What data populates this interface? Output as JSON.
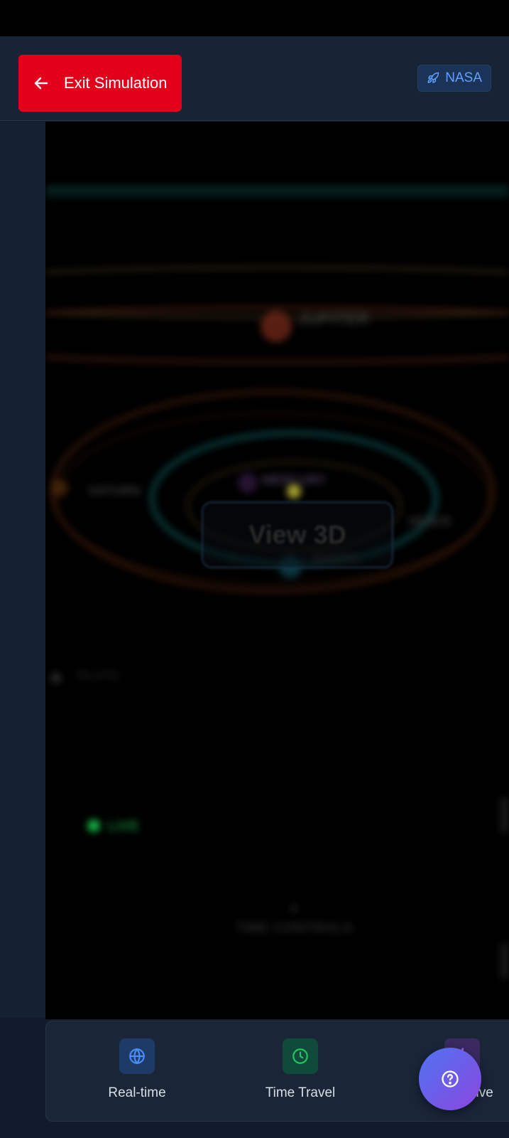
{
  "header": {
    "exit_label": "Exit Simulation",
    "badge_label": "NASA"
  },
  "viewport": {
    "view_button_label": "View 3D",
    "planet_labels": [
      "JUPITER",
      "SATURN",
      "MARS",
      "EARTH",
      "VENUS",
      "MERCURY",
      "PLUTO"
    ],
    "live_label": "LIVE",
    "time_controls_label": "TIME CONTROLS"
  },
  "features": [
    {
      "label": "Real-time",
      "icon": "globe-icon",
      "color": "#4b8df8"
    },
    {
      "label": "Time Travel",
      "icon": "clock-icon",
      "color": "#22c55e"
    },
    {
      "label": "Interactive",
      "icon": "bolt-icon",
      "color": "#a855f7"
    }
  ],
  "colors": {
    "exit_red": "#e3001b",
    "badge_blue": "#5fa1ff",
    "fab_gradient_start": "#4f74f0",
    "fab_gradient_end": "#8b46e0"
  }
}
